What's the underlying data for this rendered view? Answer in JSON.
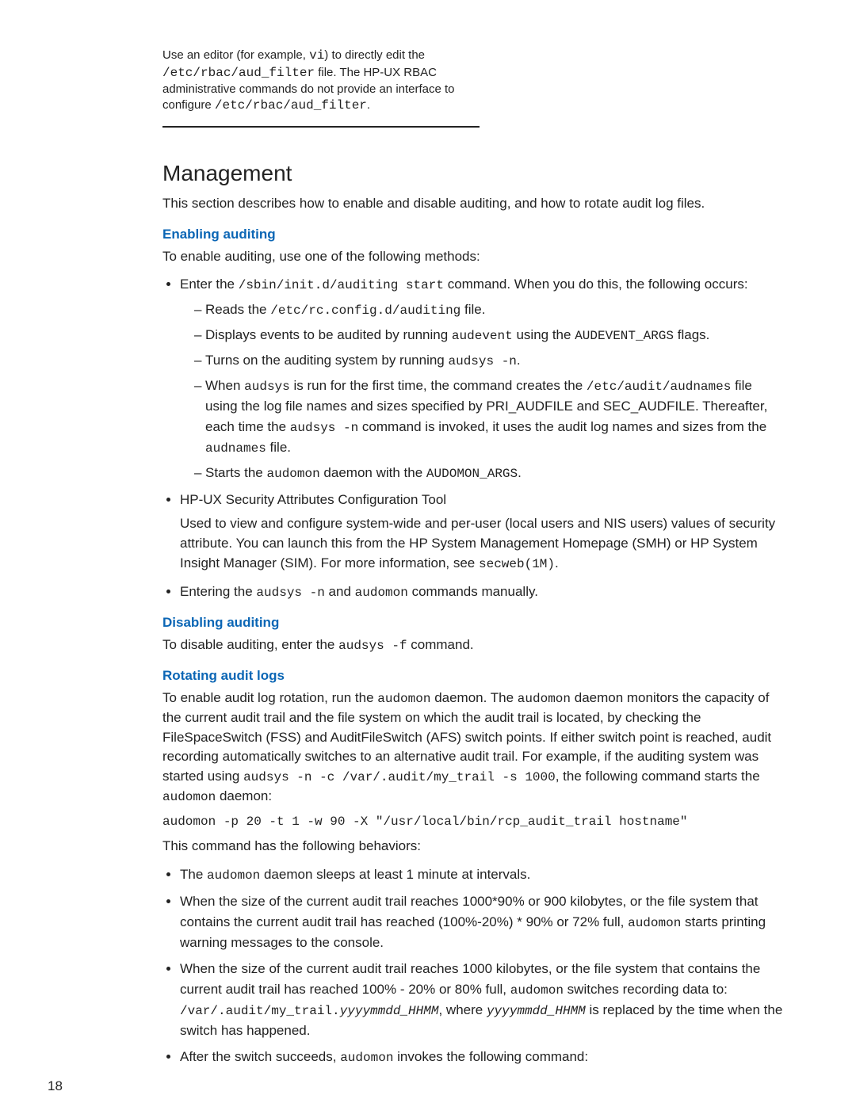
{
  "note": {
    "l1a": "Use an editor (for example, ",
    "l1b": "vi",
    "l1c": ") to directly edit the ",
    "l2": "/etc/rbac/aud_filter",
    "l2b": " file. The HP-UX RBAC administrative commands do not provide an interface to configure ",
    "l3": "/etc/rbac/aud_filter",
    "l3b": "."
  },
  "section_title": "Management",
  "section_intro": "This section describes how to enable and disable auditing, and how to rotate audit log files.",
  "enable": {
    "heading": "Enabling auditing",
    "intro": "To enable auditing, use one of the following methods:",
    "b1_a": "Enter the ",
    "b1_b": "/sbin/init.d/auditing start",
    "b1_c": " command. When you do this, the following occurs:",
    "d1_a": "Reads the ",
    "d1_b": "/etc/rc.config.d/auditing",
    "d1_c": " file.",
    "d2_a": "Displays events to be audited by running ",
    "d2_b": "audevent",
    "d2_c": " using the ",
    "d2_d": "AUDEVENT_ARGS",
    "d2_e": " flags.",
    "d3_a": "Turns on the auditing system by running ",
    "d3_b": "audsys -n",
    "d3_c": ".",
    "d4_a": "When ",
    "d4_b": "audsys",
    "d4_c": " is run for the first time, the command creates the ",
    "d4_d": "/etc/audit/audnames",
    "d4_e": " file using the log file names and sizes specified by PRI_AUDFILE and SEC_AUDFILE. Thereafter, each time the ",
    "d4_f": "audsys -n",
    "d4_g": " command is invoked, it uses the audit log names and sizes from the ",
    "d4_h": "audnames",
    "d4_i": " file.",
    "d5_a": "Starts the ",
    "d5_b": "audomon",
    "d5_c": " daemon with the ",
    "d5_d": "AUDOMON_ARGS",
    "d5_e": ".",
    "b2_title": "HP-UX Security Attributes Configuration Tool",
    "b2_body_a": "Used to view and configure system-wide and per-user (local users and NIS users) values of security attribute. You can launch this from the HP System Management Homepage (SMH) or HP System Insight Manager (SIM). For more information, see ",
    "b2_body_b": "secweb(1M)",
    "b2_body_c": ".",
    "b3_a": "Entering the ",
    "b3_b": "audsys -n",
    "b3_c": " and ",
    "b3_d": "audomon",
    "b3_e": " commands manually."
  },
  "disable": {
    "heading": "Disabling auditing",
    "line_a": "To disable auditing, enter the ",
    "line_b": "audsys -f",
    "line_c": " command."
  },
  "rotate": {
    "heading": "Rotating audit logs",
    "p1_a": "To enable audit log rotation, run the ",
    "p1_b": "audomon",
    "p1_c": " daemon. The ",
    "p1_d": "audomon",
    "p1_e": " daemon monitors the capacity of the current audit trail and the file system on which the audit trail is located, by checking the FileSpaceSwitch (FSS) and AuditFileSwitch (AFS) switch points. If either switch point is reached, audit recording automatically switches to an alternative audit trail. For example, if the auditing system was started using ",
    "p1_f": "audsys -n -c /var/.audit/my_trail -s 1000",
    "p1_g": ", the following command starts the ",
    "p1_h": "audomon",
    "p1_i": " daemon:",
    "cmd": "audomon -p 20 -t 1 -w 90 -X \"/usr/local/bin/rcp_audit_trail hostname\"",
    "p2": "This command has the following behaviors:",
    "r1_a": "The ",
    "r1_b": "audomon",
    "r1_c": " daemon sleeps at least 1 minute at intervals.",
    "r2_a": "When the size of the current audit trail reaches 1000*90% or 900 kilobytes, or the file system that contains the current audit trail has reached (100%-20%) * 90% or 72% full, ",
    "r2_b": "audomon",
    "r2_c": " starts printing warning messages to the console.",
    "r3_a": "When the size of the current audit trail reaches 1000 kilobytes, or the file system that contains the current audit trail has reached 100% - 20% or 80% full, ",
    "r3_b": "audomon",
    "r3_c": " switches recording data to: ",
    "r3_d": "/var/.audit/my_trail.",
    "r3_e": "yyyymmdd_HHMM",
    "r3_f": ", where ",
    "r3_g": "yyyymmdd_HHMM",
    "r3_h": " is replaced by the time when the switch has happened.",
    "r4_a": "After the switch succeeds, ",
    "r4_b": "audomon",
    "r4_c": " invokes the following command:"
  },
  "page_number": "18"
}
